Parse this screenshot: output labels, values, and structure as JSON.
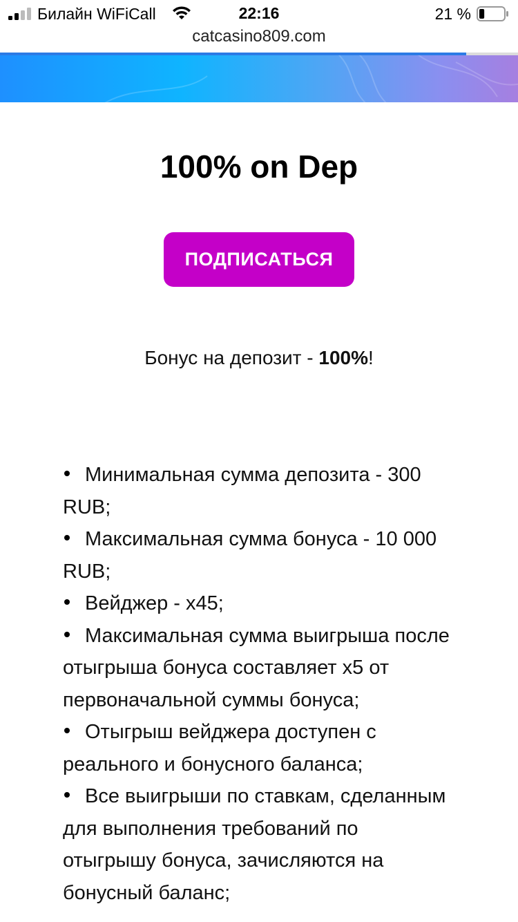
{
  "status_bar": {
    "carrier": "Билайн WiFiCall",
    "time": "22:16",
    "battery_percent": "21 %",
    "battery_level": 0.21
  },
  "browser": {
    "url": "catcasino809.com",
    "load_progress": 0.9
  },
  "main": {
    "title": "100% on Dep",
    "subscribe_label": "ПОДПИСАТЬСЯ",
    "bonus_prefix": "Бонус на депозит - ",
    "bonus_value": "100%",
    "bonus_suffix": "!",
    "terms": [
      "Минимальная сумма депозита - 300 RUB;",
      "Максимальная сумма бонуса - 10 000 RUB;",
      "Вейджер - x45;",
      "Максимальная сумма выигрыша после отыгрыша бонуса составляет x5 от первоначальной суммы бонуса;",
      "Отыгрыш вейджера доступен с реального и бонусного баланса;",
      "Все выигрыши по ставкам, сделанным для выполнения требований по отыгрышу бонуса, зачисляются на бонусный баланс;"
    ]
  },
  "colors": {
    "button": "#c400c8",
    "progress": "#2c7be5"
  }
}
